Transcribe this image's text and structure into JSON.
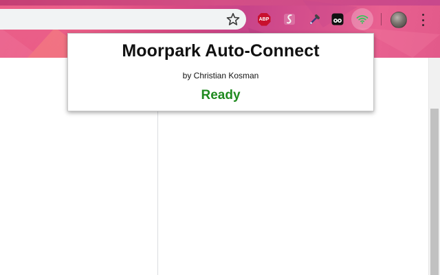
{
  "popup": {
    "title": "Moorpark Auto-Connect",
    "author": "by Christian Kosman",
    "status": "Ready",
    "status_color": "#1f8a1f"
  },
  "toolbar": {
    "extensions": [
      {
        "name": "adblock-plus",
        "label": "ABP",
        "color": "#c8102e"
      },
      {
        "name": "stylus",
        "icon": "stylus-icon"
      },
      {
        "name": "eyedropper",
        "icon": "eyedropper-icon"
      },
      {
        "name": "tampermonkey",
        "icon": "tampermonkey-icon"
      },
      {
        "name": "moorpark-auto-connect",
        "icon": "wifi-icon",
        "color": "#34c759"
      }
    ],
    "bookmark_icon": "star-icon",
    "menu_icon": "more-vert-icon"
  },
  "theme": {
    "accent": "#e25a8a"
  }
}
